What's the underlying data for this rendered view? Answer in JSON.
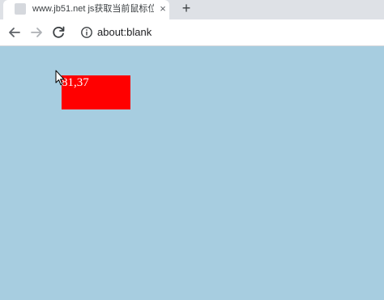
{
  "tab": {
    "title": "www.jb51.net js获取当前鼠标位",
    "close_glyph": "×",
    "new_tab_glyph": "+"
  },
  "toolbar": {
    "back_icon": "arrow-left-icon",
    "forward_icon": "arrow-right-icon",
    "reload_icon": "reload-icon",
    "info_icon": "info-icon",
    "url": "about:blank"
  },
  "page": {
    "background": "#a7cde0",
    "box_color": "#ff0000",
    "coordinates_text": "81,37"
  }
}
